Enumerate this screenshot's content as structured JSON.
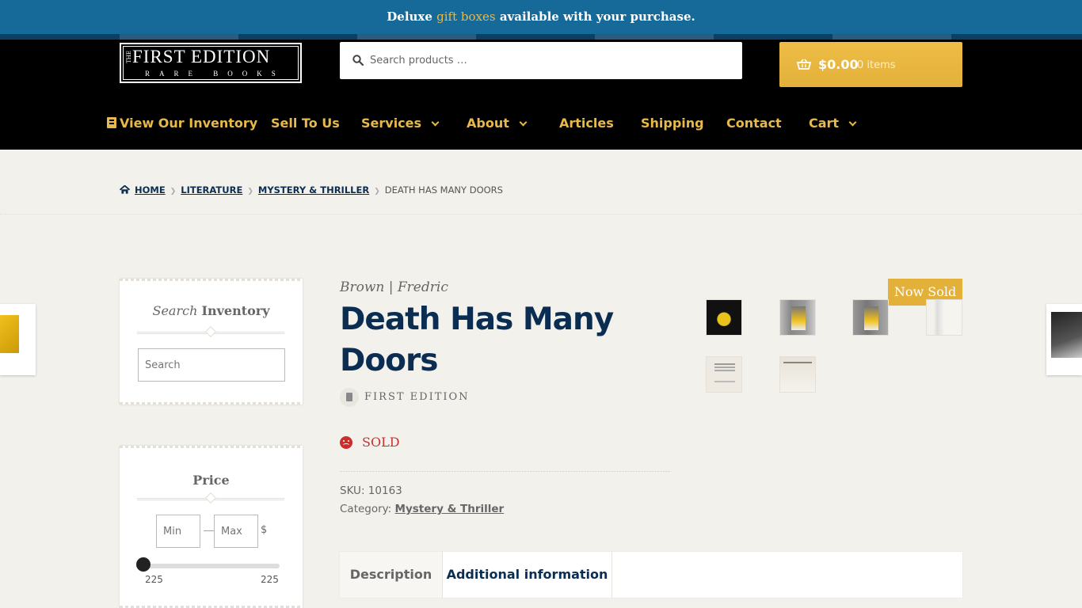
{
  "promo": {
    "prefix": "Deluxe",
    "highlight": "gift boxes",
    "suffix": "available with your purchase."
  },
  "logo": {
    "the": "THE",
    "title": "FIRST EDITION",
    "subtitle": "RARE BOOKS"
  },
  "search": {
    "placeholder": "Search products …"
  },
  "cart": {
    "amount": "$0.00",
    "items": "0 items"
  },
  "nav": {
    "items": [
      {
        "label": "View Our Inventory",
        "icon": "book-icon"
      },
      {
        "label": "Sell To Us"
      },
      {
        "label": "Services",
        "has_dropdown": true
      },
      {
        "label": "About",
        "has_dropdown": true
      },
      {
        "label": "Articles"
      },
      {
        "label": "Shipping"
      },
      {
        "label": "Contact"
      },
      {
        "label": "Cart",
        "has_dropdown": true
      }
    ]
  },
  "breadcrumb": {
    "home": "HOME",
    "literature": "LITERATURE",
    "category": "MYSTERY & THRILLER",
    "current": "DEATH HAS MANY DOORS"
  },
  "sidebar": {
    "search_widget": {
      "title_italic": "Search",
      "title_bold": "Inventory",
      "placeholder": "Search"
    },
    "price_widget": {
      "title": "Price",
      "min_placeholder": "Min",
      "max_placeholder": "Max",
      "dash": "—",
      "currency": "$",
      "range_min": "225",
      "range_max": "225",
      "slider_position": 0
    }
  },
  "product": {
    "author": "Brown | Fredric",
    "title": "Death Has Many Doors",
    "edition": "FIRST EDITION",
    "status": "SOLD",
    "sku_label": "SKU:",
    "sku": "10163",
    "category_label": "Category:",
    "category": "Mystery & Thriller",
    "sold_badge": "Now Sold"
  },
  "tabs": [
    {
      "label": "Description"
    },
    {
      "label": "Additional information"
    }
  ],
  "colors": {
    "navy": "#0c2d52",
    "gold": "#e6b94a",
    "promo_blue": "#166a9a",
    "sold_red": "#c9302c"
  }
}
